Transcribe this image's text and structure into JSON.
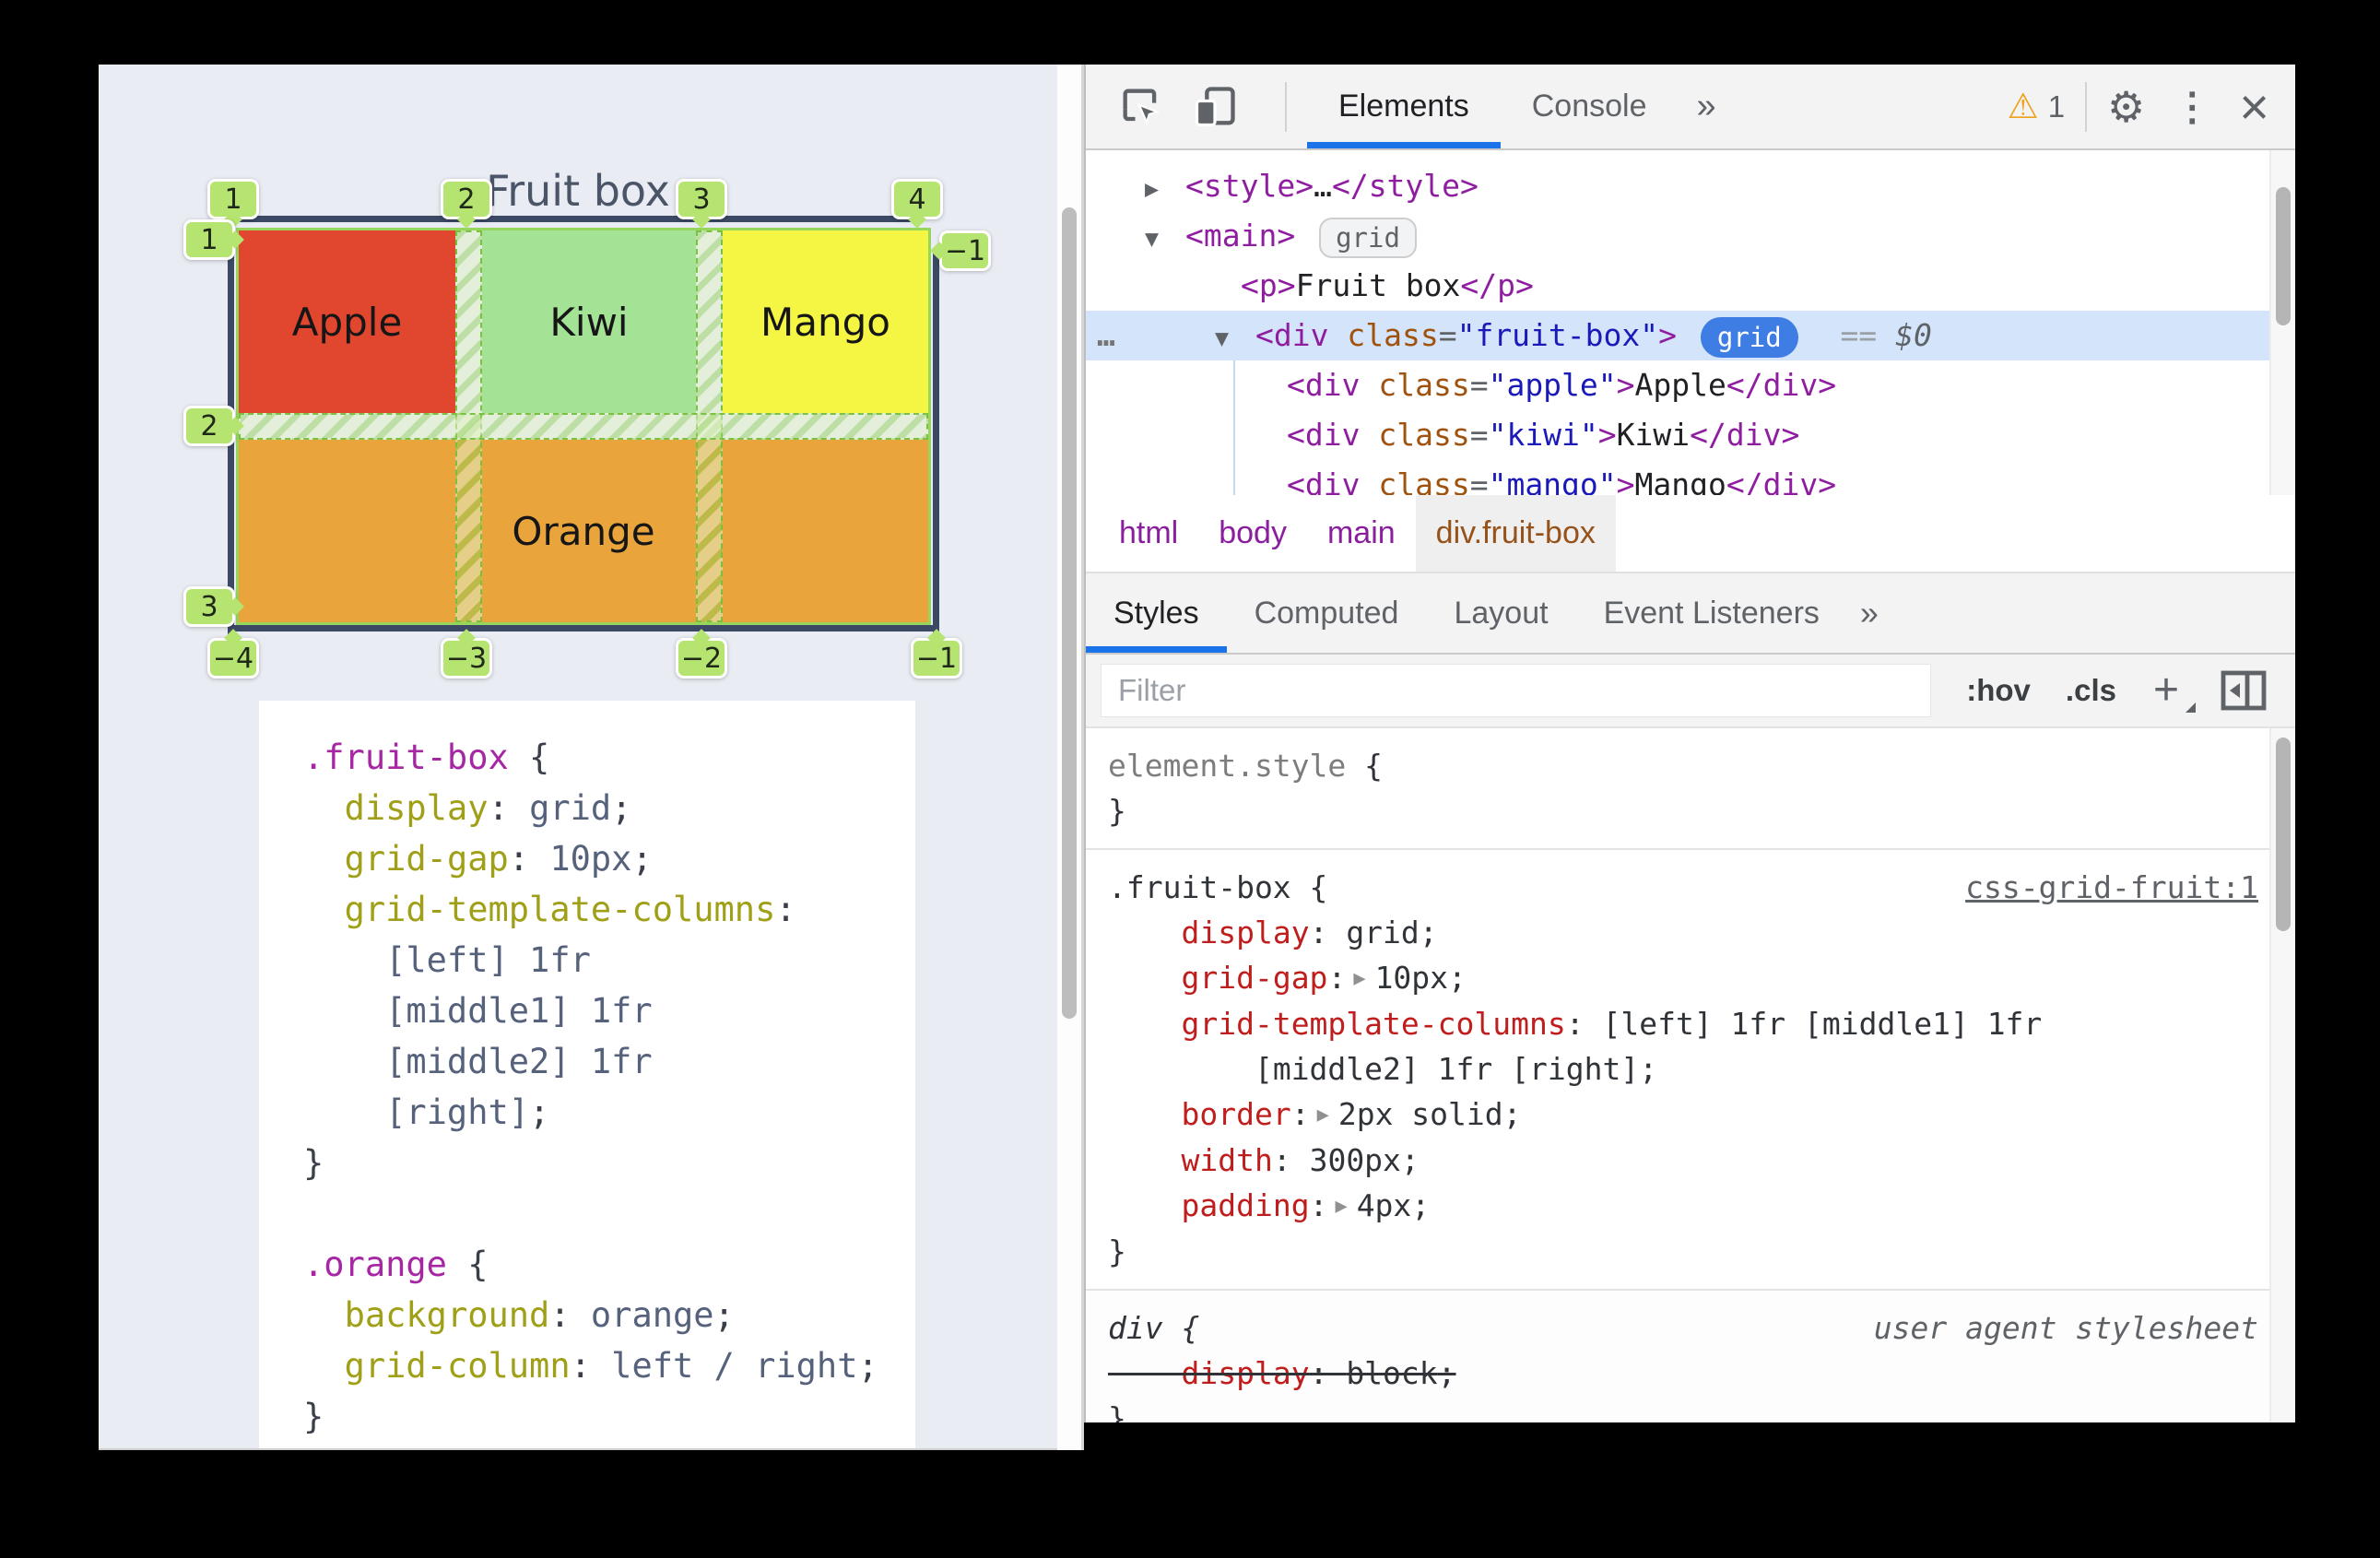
{
  "page": {
    "title": "Fruit box",
    "grid": {
      "top_labels": [
        "1",
        "2",
        "3",
        "4"
      ],
      "left_labels": [
        "1",
        "2",
        "3"
      ],
      "bottom_labels": [
        "−4",
        "−3",
        "−2",
        "−1"
      ],
      "right_label": "−1",
      "cells": {
        "apple": "Apple",
        "kiwi": "Kiwi",
        "mango": "Mango",
        "orange": "Orange"
      }
    },
    "code_lines": [
      {
        "tokens": [
          {
            "t": ".fruit-box",
            "c": "psel"
          },
          {
            "t": " {",
            "c": "ppun"
          }
        ]
      },
      {
        "tokens": [
          {
            "t": "  ",
            "c": ""
          },
          {
            "t": "display",
            "c": "pprop"
          },
          {
            "t": ": ",
            "c": "ppun"
          },
          {
            "t": "grid",
            "c": "pval"
          },
          {
            "t": ";",
            "c": "ppun"
          }
        ]
      },
      {
        "tokens": [
          {
            "t": "  ",
            "c": ""
          },
          {
            "t": "grid-gap",
            "c": "pprop"
          },
          {
            "t": ": ",
            "c": "ppun"
          },
          {
            "t": "10px",
            "c": "pval"
          },
          {
            "t": ";",
            "c": "ppun"
          }
        ]
      },
      {
        "tokens": [
          {
            "t": "  ",
            "c": ""
          },
          {
            "t": "grid-template-columns",
            "c": "pprop"
          },
          {
            "t": ":",
            "c": "ppun"
          }
        ]
      },
      {
        "tokens": [
          {
            "t": "    ",
            "c": ""
          },
          {
            "t": "[left] 1fr",
            "c": "pval"
          }
        ]
      },
      {
        "tokens": [
          {
            "t": "    ",
            "c": ""
          },
          {
            "t": "[middle1] 1fr",
            "c": "pval"
          }
        ]
      },
      {
        "tokens": [
          {
            "t": "    ",
            "c": ""
          },
          {
            "t": "[middle2] 1fr",
            "c": "pval"
          }
        ]
      },
      {
        "tokens": [
          {
            "t": "    ",
            "c": ""
          },
          {
            "t": "[right]",
            "c": "pval"
          },
          {
            "t": ";",
            "c": "ppun"
          }
        ]
      },
      {
        "tokens": [
          {
            "t": "}",
            "c": "ppun"
          }
        ]
      },
      {
        "tokens": [
          {
            "t": " ",
            "c": ""
          }
        ]
      },
      {
        "tokens": [
          {
            "t": ".orange",
            "c": "psel"
          },
          {
            "t": " {",
            "c": "ppun"
          }
        ]
      },
      {
        "tokens": [
          {
            "t": "  ",
            "c": ""
          },
          {
            "t": "background",
            "c": "pprop"
          },
          {
            "t": ": ",
            "c": "ppun"
          },
          {
            "t": "orange",
            "c": "pval"
          },
          {
            "t": ";",
            "c": "ppun"
          }
        ]
      },
      {
        "tokens": [
          {
            "t": "  ",
            "c": ""
          },
          {
            "t": "grid-column",
            "c": "pprop"
          },
          {
            "t": ": ",
            "c": "ppun"
          },
          {
            "t": "left / right",
            "c": "pval"
          },
          {
            "t": ";",
            "c": "ppun"
          }
        ]
      },
      {
        "tokens": [
          {
            "t": "}",
            "c": "ppun"
          }
        ]
      }
    ]
  },
  "devtools": {
    "toolbar": {
      "elements": "Elements",
      "console": "Console",
      "more_glyph": "»",
      "warning_glyph": "⚠",
      "warning_count": "1",
      "gear_glyph": "⚙",
      "menu_glyph": "⋮",
      "close_glyph": "×"
    },
    "dom_rows": [
      {
        "indent": 64,
        "chev": "▶",
        "tokens": [
          {
            "t": "<style>",
            "c": "tag"
          },
          {
            "t": "…",
            "c": "txt"
          },
          {
            "t": "</style>",
            "c": "tag"
          }
        ]
      },
      {
        "indent": 64,
        "chev": "▼",
        "tokens": [
          {
            "t": "<main>",
            "c": "tag"
          },
          {
            "t": " ",
            "c": ""
          },
          {
            "t": "grid",
            "c": "badge-gray"
          }
        ]
      },
      {
        "indent": 168,
        "tokens": [
          {
            "t": "<p>",
            "c": "tag"
          },
          {
            "t": "Fruit box",
            "c": "txt"
          },
          {
            "t": "</p>",
            "c": "tag"
          }
        ]
      },
      {
        "indent": 140,
        "chev": "▼",
        "selected": true,
        "marker": "…",
        "tokens": [
          {
            "t": "<div",
            "c": "tag"
          },
          {
            "t": " class",
            "c": "attr"
          },
          {
            "t": "=",
            "c": "pun"
          },
          {
            "t": "\"fruit-box\"",
            "c": "str"
          },
          {
            "t": ">",
            "c": "tag"
          },
          {
            "t": " ",
            "c": ""
          },
          {
            "t": "grid",
            "c": "badge-blue"
          },
          {
            "t": "  ",
            "c": ""
          },
          {
            "t": "==",
            "c": "eq"
          },
          {
            "t": " ",
            "c": ""
          },
          {
            "t": "$0",
            "c": "dollar"
          }
        ]
      },
      {
        "indent": 218,
        "tokens": [
          {
            "t": "<div",
            "c": "tag"
          },
          {
            "t": " class",
            "c": "attr"
          },
          {
            "t": "=",
            "c": "pun"
          },
          {
            "t": "\"apple\"",
            "c": "str"
          },
          {
            "t": ">",
            "c": "tag"
          },
          {
            "t": "Apple",
            "c": "txt"
          },
          {
            "t": "</div>",
            "c": "tag"
          }
        ]
      },
      {
        "indent": 218,
        "tokens": [
          {
            "t": "<div",
            "c": "tag"
          },
          {
            "t": " class",
            "c": "attr"
          },
          {
            "t": "=",
            "c": "pun"
          },
          {
            "t": "\"kiwi\"",
            "c": "str"
          },
          {
            "t": ">",
            "c": "tag"
          },
          {
            "t": "Kiwi",
            "c": "txt"
          },
          {
            "t": "</div>",
            "c": "tag"
          }
        ]
      },
      {
        "indent": 218,
        "tokens": [
          {
            "t": "<div",
            "c": "tag"
          },
          {
            "t": " class",
            "c": "attr"
          },
          {
            "t": "=",
            "c": "pun"
          },
          {
            "t": "\"mango\"",
            "c": "str"
          },
          {
            "t": ">",
            "c": "tag"
          },
          {
            "t": "Mango",
            "c": "txt"
          },
          {
            "t": "</div>",
            "c": "tag"
          }
        ]
      }
    ],
    "breadcrumb": [
      "html",
      "body",
      "main",
      "div.fruit-box"
    ],
    "panel_tabs": {
      "styles": "Styles",
      "computed": "Computed",
      "layout": "Layout",
      "event_listeners": "Event Listeners",
      "more": "»"
    },
    "filter": {
      "placeholder": "Filter",
      "hov": ":hov",
      "cls": ".cls",
      "add": "+"
    },
    "styles": {
      "element_style": [
        {
          "tokens": [
            {
              "t": "element.style",
              "c": "gsel"
            },
            {
              "t": " {",
              "c": "d"
            }
          ]
        },
        {
          "tokens": [
            {
              "t": "}",
              "c": "d"
            }
          ]
        }
      ],
      "fruit_box_rule": [
        {
          "tokens": [
            {
              "t": ".fruit-box",
              "c": "d"
            },
            {
              "t": " {",
              "c": "d"
            }
          ],
          "right": {
            "t": "css-grid-fruit:1",
            "c": "link"
          }
        },
        {
          "tokens": [
            {
              "t": "    ",
              "c": ""
            },
            {
              "t": "display",
              "c": "prop"
            },
            {
              "t": ": ",
              "c": "d"
            },
            {
              "t": "grid",
              "c": "val"
            },
            {
              "t": ";",
              "c": "d"
            }
          ]
        },
        {
          "tokens": [
            {
              "t": "    ",
              "c": ""
            },
            {
              "t": "grid-gap",
              "c": "prop"
            },
            {
              "t": ":",
              "c": "d"
            },
            {
              "t": "▶",
              "c": "arrow"
            },
            {
              "t": "10px",
              "c": "val"
            },
            {
              "t": ";",
              "c": "d"
            }
          ]
        },
        {
          "tokens": [
            {
              "t": "    ",
              "c": ""
            },
            {
              "t": "grid-template-columns",
              "c": "prop"
            },
            {
              "t": ": ",
              "c": "d"
            },
            {
              "t": "[left] 1fr [middle1] 1fr",
              "c": "val"
            }
          ]
        },
        {
          "tokens": [
            {
              "t": "        ",
              "c": ""
            },
            {
              "t": "[middle2] 1fr [right]",
              "c": "val"
            },
            {
              "t": ";",
              "c": "d"
            }
          ]
        },
        {
          "tokens": [
            {
              "t": "    ",
              "c": ""
            },
            {
              "t": "border",
              "c": "prop"
            },
            {
              "t": ":",
              "c": "d"
            },
            {
              "t": "▶",
              "c": "arrow"
            },
            {
              "t": "2px solid",
              "c": "val"
            },
            {
              "t": ";",
              "c": "d"
            }
          ]
        },
        {
          "tokens": [
            {
              "t": "    ",
              "c": ""
            },
            {
              "t": "width",
              "c": "prop"
            },
            {
              "t": ": ",
              "c": "d"
            },
            {
              "t": "300px",
              "c": "val"
            },
            {
              "t": ";",
              "c": "d"
            }
          ]
        },
        {
          "tokens": [
            {
              "t": "    ",
              "c": ""
            },
            {
              "t": "padding",
              "c": "prop"
            },
            {
              "t": ":",
              "c": "d"
            },
            {
              "t": "▶",
              "c": "arrow"
            },
            {
              "t": "4px",
              "c": "val"
            },
            {
              "t": ";",
              "c": "d"
            }
          ]
        },
        {
          "tokens": [
            {
              "t": "}",
              "c": "d"
            }
          ]
        }
      ],
      "user_agent_rule": [
        {
          "tokens": [
            {
              "t": "div",
              "c": "d ital"
            },
            {
              "t": " {",
              "c": "d ital"
            }
          ],
          "right": {
            "t": "user agent stylesheet",
            "c": "ua"
          }
        },
        {
          "strike": true,
          "tokens": [
            {
              "t": "    ",
              "c": ""
            },
            {
              "t": "display",
              "c": "prop"
            },
            {
              "t": ": ",
              "c": "d"
            },
            {
              "t": "block",
              "c": "val"
            },
            {
              "t": ";",
              "c": "d"
            }
          ]
        },
        {
          "tokens": [
            {
              "t": "}",
              "c": "d"
            }
          ]
        }
      ]
    }
  },
  "colors": {
    "accent_blue": "#1a73e8",
    "dom_selection": "#d4e5fb",
    "grid_badge_green": "#b5e470",
    "overlay_navy": "#3b4964",
    "apple": "#e0472e",
    "kiwi": "#a4e295",
    "mango": "#f5f643",
    "orange": "#e9a43c",
    "warning_amber": "#efa11b"
  }
}
